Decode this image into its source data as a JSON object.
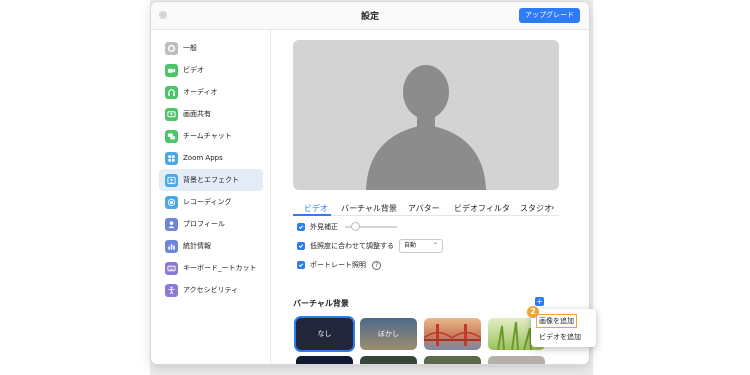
{
  "window": {
    "title": "設定",
    "upgrade_label": "アップグレード"
  },
  "sidebar": {
    "items": [
      {
        "label": "一般",
        "icon": "gear-icon",
        "color": "#bdbdbd"
      },
      {
        "label": "ビデオ",
        "icon": "video-camera-icon",
        "color": "#4ec46a"
      },
      {
        "label": "オーディオ",
        "icon": "headphones-icon",
        "color": "#4ec46a"
      },
      {
        "label": "画面共有",
        "icon": "screen-share-icon",
        "color": "#4ec46a"
      },
      {
        "label": "チームチャット",
        "icon": "chat-bubble-icon",
        "color": "#4ec46a"
      },
      {
        "label": "Zoom Apps",
        "icon": "apps-icon",
        "color": "#4aa7e8"
      },
      {
        "label": "背景とエフェクト",
        "icon": "portrait-icon",
        "color": "#4aa7e8"
      },
      {
        "label": "レコーディング",
        "icon": "record-icon",
        "color": "#4aa7e8"
      },
      {
        "label": "プロフィール",
        "icon": "person-icon",
        "color": "#6f86d6"
      },
      {
        "label": "統計情報",
        "icon": "bar-chart-icon",
        "color": "#6f86d6"
      },
      {
        "label": "キーボード_ートカット",
        "icon": "keyboard-icon",
        "color": "#8e7ad6"
      },
      {
        "label": "アクセシビリティ",
        "icon": "accessibility-icon",
        "color": "#8e7ad6"
      }
    ],
    "active_index": 6
  },
  "tabs": [
    "ビデオ",
    "バーチャル背景",
    "アバター",
    "ビデオフィルタ",
    "スタジオ"
  ],
  "tab_more": "›",
  "options": {
    "touch_up": "外見補正",
    "low_light": "低照度に合わせて調整する",
    "low_light_value": "自動",
    "portrait_lighting": "ポートレート照明"
  },
  "virtual_bg": {
    "title": "バーチャル背景",
    "add_symbol": "+",
    "thumbs": [
      {
        "label": "なし"
      },
      {
        "label": "ぼかし"
      },
      {
        "label": ""
      },
      {
        "label": ""
      }
    ]
  },
  "popup": {
    "add_image": "画像を追加",
    "add_video": "ビデオを追加"
  },
  "step_badge": "2",
  "colors": {
    "accent": "#2d7cf6",
    "highlight": "#f0a33a"
  }
}
